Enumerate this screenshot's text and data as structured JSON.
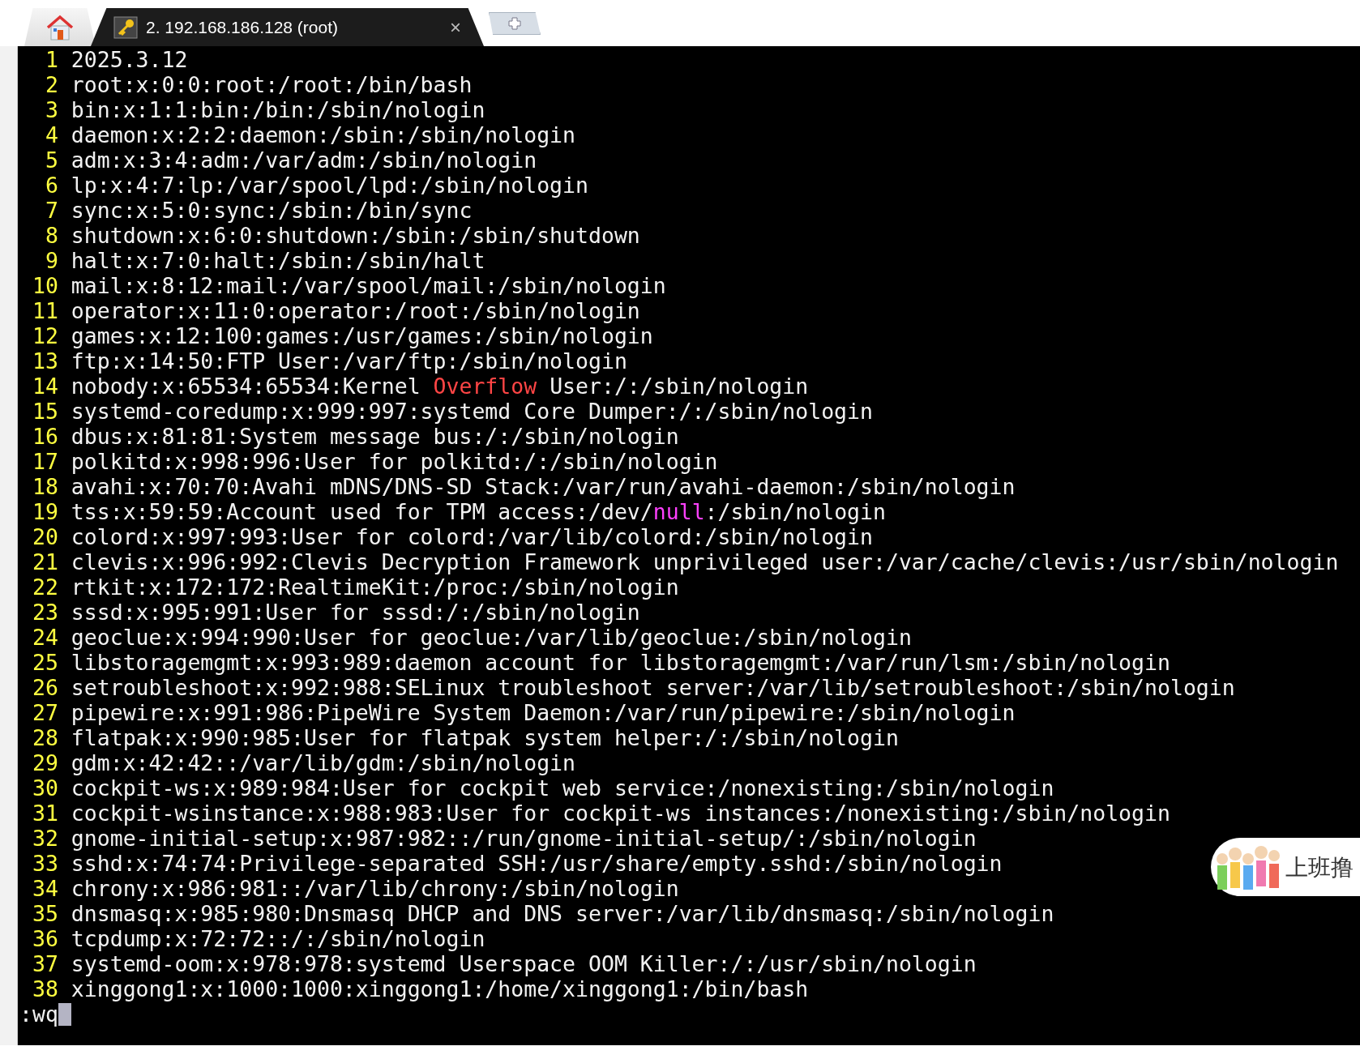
{
  "tabs": [
    {
      "kind": "home",
      "selected": false
    },
    {
      "kind": "session",
      "label": "2. 192.168.186.128 (root)",
      "close": "×",
      "selected": true
    }
  ],
  "terminal": {
    "lines": [
      {
        "number": "1",
        "segments": [
          {
            "text": "2025.3.12",
            "kind": "plain"
          }
        ]
      },
      {
        "number": "2",
        "segments": [
          {
            "text": "root:x:0:0:root:/root:/bin/bash",
            "kind": "plain"
          }
        ]
      },
      {
        "number": "3",
        "segments": [
          {
            "text": "bin:x:1:1:bin:/bin:/sbin/nologin",
            "kind": "plain"
          }
        ]
      },
      {
        "number": "4",
        "segments": [
          {
            "text": "daemon:x:2:2:daemon:/sbin:/sbin/nologin",
            "kind": "plain"
          }
        ]
      },
      {
        "number": "5",
        "segments": [
          {
            "text": "adm:x:3:4:adm:/var/adm:/sbin/nologin",
            "kind": "plain"
          }
        ]
      },
      {
        "number": "6",
        "segments": [
          {
            "text": "lp:x:4:7:lp:/var/spool/lpd:/sbin/nologin",
            "kind": "plain"
          }
        ]
      },
      {
        "number": "7",
        "segments": [
          {
            "text": "sync:x:5:0:sync:/sbin:/bin/sync",
            "kind": "plain"
          }
        ]
      },
      {
        "number": "8",
        "segments": [
          {
            "text": "shutdown:x:6:0:shutdown:/sbin:/sbin/shutdown",
            "kind": "plain"
          }
        ]
      },
      {
        "number": "9",
        "segments": [
          {
            "text": "halt:x:7:0:halt:/sbin:/sbin/halt",
            "kind": "plain"
          }
        ]
      },
      {
        "number": "10",
        "segments": [
          {
            "text": "mail:x:8:12:mail:/var/spool/mail:/sbin/nologin",
            "kind": "plain"
          }
        ]
      },
      {
        "number": "11",
        "segments": [
          {
            "text": "operator:x:11:0:operator:/root:/sbin/nologin",
            "kind": "plain"
          }
        ]
      },
      {
        "number": "12",
        "segments": [
          {
            "text": "games:x:12:100:games:/usr/games:/sbin/nologin",
            "kind": "plain"
          }
        ]
      },
      {
        "number": "13",
        "segments": [
          {
            "text": "ftp:x:14:50:FTP User:/var/ftp:/sbin/nologin",
            "kind": "plain"
          }
        ]
      },
      {
        "number": "14",
        "segments": [
          {
            "text": "nobody:x:65534:65534:Kernel ",
            "kind": "plain"
          },
          {
            "text": "Overflow",
            "kind": "error"
          },
          {
            "text": " User:/:/sbin/nologin",
            "kind": "plain"
          }
        ]
      },
      {
        "number": "15",
        "segments": [
          {
            "text": "systemd-coredump:x:999:997:systemd Core Dumper:/:/sbin/nologin",
            "kind": "plain"
          }
        ]
      },
      {
        "number": "16",
        "segments": [
          {
            "text": "dbus:x:81:81:System message bus:/:/sbin/nologin",
            "kind": "plain"
          }
        ]
      },
      {
        "number": "17",
        "segments": [
          {
            "text": "polkitd:x:998:996:User for polkitd:/:/sbin/nologin",
            "kind": "plain"
          }
        ]
      },
      {
        "number": "18",
        "segments": [
          {
            "text": "avahi:x:70:70:Avahi mDNS/DNS-SD Stack:/var/run/avahi-daemon:/sbin/nologin",
            "kind": "plain"
          }
        ]
      },
      {
        "number": "19",
        "segments": [
          {
            "text": "tss:x:59:59:Account used for TPM access:/dev/",
            "kind": "plain"
          },
          {
            "text": "null",
            "kind": "constant"
          },
          {
            "text": ":/sbin/nologin",
            "kind": "plain"
          }
        ]
      },
      {
        "number": "20",
        "segments": [
          {
            "text": "colord:x:997:993:User for colord:/var/lib/colord:/sbin/nologin",
            "kind": "plain"
          }
        ]
      },
      {
        "number": "21",
        "segments": [
          {
            "text": "clevis:x:996:992:Clevis Decryption Framework unprivileged user:/var/cache/clevis:/usr/sbin/nologin",
            "kind": "plain"
          }
        ]
      },
      {
        "number": "22",
        "segments": [
          {
            "text": "rtkit:x:172:172:RealtimeKit:/proc:/sbin/nologin",
            "kind": "plain"
          }
        ]
      },
      {
        "number": "23",
        "segments": [
          {
            "text": "sssd:x:995:991:User for sssd:/:/sbin/nologin",
            "kind": "plain"
          }
        ]
      },
      {
        "number": "24",
        "segments": [
          {
            "text": "geoclue:x:994:990:User for geoclue:/var/lib/geoclue:/sbin/nologin",
            "kind": "plain"
          }
        ]
      },
      {
        "number": "25",
        "segments": [
          {
            "text": "libstoragemgmt:x:993:989:daemon account for libstoragemgmt:/var/run/lsm:/sbin/nologin",
            "kind": "plain"
          }
        ]
      },
      {
        "number": "26",
        "segments": [
          {
            "text": "setroubleshoot:x:992:988:SELinux troubleshoot server:/var/lib/setroubleshoot:/sbin/nologin",
            "kind": "plain"
          }
        ]
      },
      {
        "number": "27",
        "segments": [
          {
            "text": "pipewire:x:991:986:PipeWire System Daemon:/var/run/pipewire:/sbin/nologin",
            "kind": "plain"
          }
        ]
      },
      {
        "number": "28",
        "segments": [
          {
            "text": "flatpak:x:990:985:User for flatpak system helper:/:/sbin/nologin",
            "kind": "plain"
          }
        ]
      },
      {
        "number": "29",
        "segments": [
          {
            "text": "gdm:x:42:42::/var/lib/gdm:/sbin/nologin",
            "kind": "plain"
          }
        ]
      },
      {
        "number": "30",
        "segments": [
          {
            "text": "cockpit-ws:x:989:984:User for cockpit web service:/nonexisting:/sbin/nologin",
            "kind": "plain"
          }
        ]
      },
      {
        "number": "31",
        "segments": [
          {
            "text": "cockpit-wsinstance:x:988:983:User for cockpit-ws instances:/nonexisting:/sbin/nologin",
            "kind": "plain"
          }
        ]
      },
      {
        "number": "32",
        "segments": [
          {
            "text": "gnome-initial-setup:x:987:982::/run/gnome-initial-setup/:/sbin/nologin",
            "kind": "plain"
          }
        ]
      },
      {
        "number": "33",
        "segments": [
          {
            "text": "sshd:x:74:74:Privilege-separated SSH:/usr/share/empty.sshd:/sbin/nologin",
            "kind": "plain"
          }
        ]
      },
      {
        "number": "34",
        "segments": [
          {
            "text": "chrony:x:986:981::/var/lib/chrony:/sbin/nologin",
            "kind": "plain"
          }
        ]
      },
      {
        "number": "35",
        "segments": [
          {
            "text": "dnsmasq:x:985:980:Dnsmasq DHCP and DNS server:/var/lib/dnsmasq:/sbin/nologin",
            "kind": "plain"
          }
        ]
      },
      {
        "number": "36",
        "segments": [
          {
            "text": "tcpdump:x:72:72::/:/sbin/nologin",
            "kind": "plain"
          }
        ]
      },
      {
        "number": "37",
        "segments": [
          {
            "text": "systemd-oom:x:978:978:systemd Userspace OOM Killer:/:/usr/sbin/nologin",
            "kind": "plain"
          }
        ]
      },
      {
        "number": "38",
        "segments": [
          {
            "text": "xinggong1:x:1000:1000:xinggong1:/home/xinggong1:/bin/bash",
            "kind": "plain"
          }
        ]
      }
    ],
    "command": ":wq"
  },
  "widget": {
    "label": "上班撸"
  }
}
